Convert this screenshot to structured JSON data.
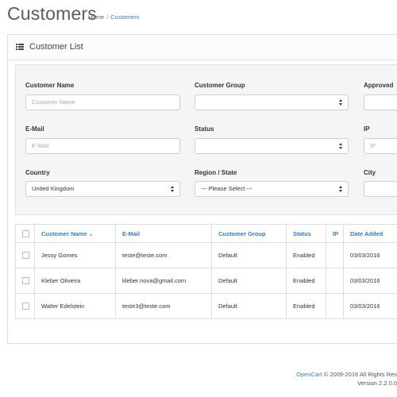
{
  "page": {
    "title": "Customers",
    "breadcrumb": [
      {
        "label": "Home"
      },
      {
        "label": "Customers"
      }
    ],
    "breadcrumb_sep": "/"
  },
  "panel": {
    "title": "Customer List",
    "icon": "list-icon"
  },
  "filters": {
    "customer_name": {
      "label": "Customer Name",
      "placeholder": "Customer Name",
      "value": ""
    },
    "customer_group": {
      "label": "Customer Group",
      "value": ""
    },
    "approved": {
      "label": "Approved",
      "value": ""
    },
    "email": {
      "label": "E-Mail",
      "placeholder": "E-Mail",
      "value": ""
    },
    "status": {
      "label": "Status",
      "value": ""
    },
    "ip": {
      "label": "IP",
      "placeholder": "IP",
      "value": ""
    },
    "country": {
      "label": "Country",
      "value": "United Kingdom"
    },
    "region": {
      "label": "Region / State",
      "value": "--- Please Select ---"
    },
    "city": {
      "label": "City",
      "value": ""
    }
  },
  "table": {
    "columns": [
      "Customer Name",
      "E-Mail",
      "Customer Group",
      "Status",
      "IP",
      "Date Added"
    ],
    "sort_indicator": "chevron-down-icon",
    "rows": [
      {
        "name": "Jessy Gomes",
        "email": "teste@teste.com",
        "group": "Default",
        "status": "Enabled",
        "ip": "",
        "date": "03/03/2016"
      },
      {
        "name": "Kleber Oliveira",
        "email": "kleber.nova@gmail.com",
        "group": "Default",
        "status": "Enabled",
        "ip": "",
        "date": "03/03/2016"
      },
      {
        "name": "Walter Edelstein",
        "email": "teste3@teste.com",
        "group": "Default",
        "status": "Enabled",
        "ip": "",
        "date": "03/03/2016"
      }
    ]
  },
  "footer": {
    "brand": "OpenCart",
    "copyright": " © 2009-2016 All Rights Res",
    "version": "Version 2.2.0.0"
  },
  "colors": {
    "link": "#3a7bbd",
    "well": "#f5f5f5",
    "title": "#545e66"
  }
}
